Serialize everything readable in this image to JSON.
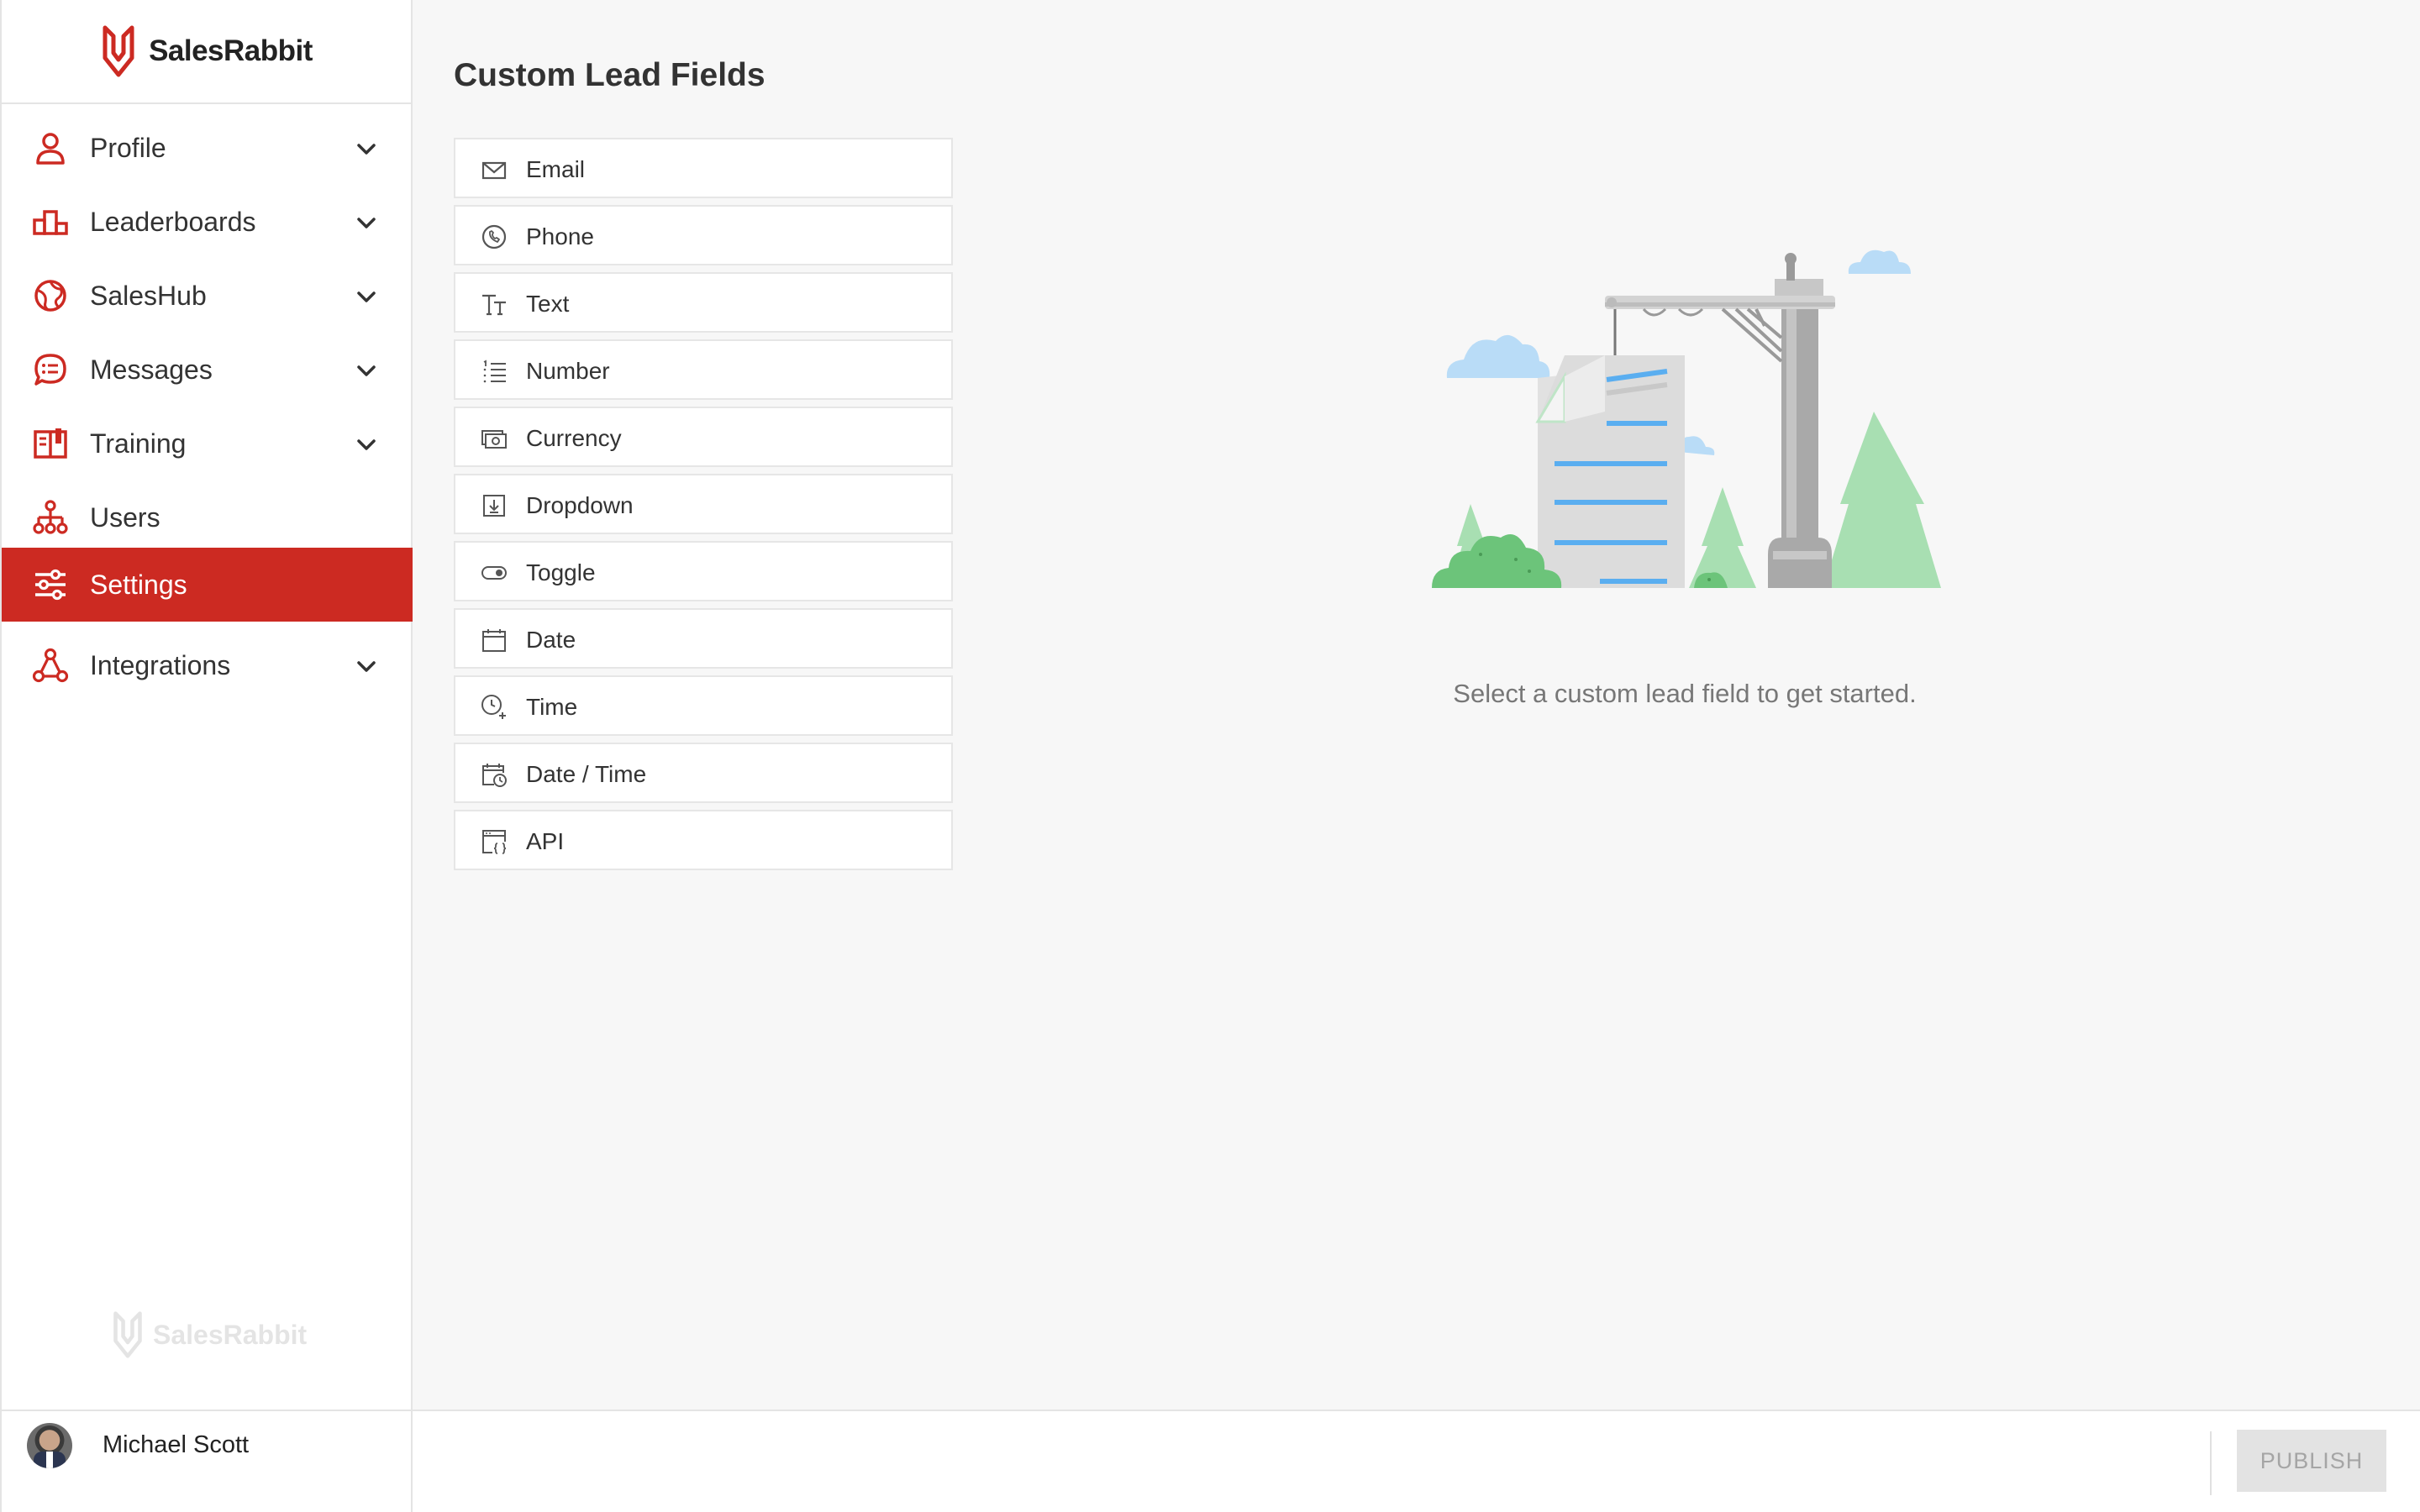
{
  "brand": {
    "name": "SalesRabbit",
    "accent": "#cc2a22"
  },
  "sidebar": {
    "items": [
      {
        "label": "Profile",
        "icon": "person-icon",
        "expandable": true
      },
      {
        "label": "Leaderboards",
        "icon": "podium-icon",
        "expandable": true
      },
      {
        "label": "SalesHub",
        "icon": "globe-icon",
        "expandable": true
      },
      {
        "label": "Messages",
        "icon": "chat-bubble-icon",
        "expandable": true
      },
      {
        "label": "Training",
        "icon": "book-icon",
        "expandable": true
      },
      {
        "label": "Users",
        "icon": "org-chart-icon",
        "expandable": false
      },
      {
        "label": "Settings",
        "icon": "sliders-icon",
        "expandable": false,
        "active": true
      },
      {
        "label": "Integrations",
        "icon": "nodes-icon",
        "expandable": true
      }
    ],
    "watermark": "SalesRabbit"
  },
  "main": {
    "title": "Custom Lead Fields",
    "fields": [
      {
        "label": "Email",
        "icon": "envelope-icon"
      },
      {
        "label": "Phone",
        "icon": "phone-icon"
      },
      {
        "label": "Text",
        "icon": "text-size-icon"
      },
      {
        "label": "Number",
        "icon": "numbered-list-icon"
      },
      {
        "label": "Currency",
        "icon": "cash-icon"
      },
      {
        "label": "Dropdown",
        "icon": "download-box-icon"
      },
      {
        "label": "Toggle",
        "icon": "toggle-icon"
      },
      {
        "label": "Date",
        "icon": "calendar-icon"
      },
      {
        "label": "Time",
        "icon": "clock-plus-icon"
      },
      {
        "label": "Date / Time",
        "icon": "calendar-clock-icon"
      },
      {
        "label": "API",
        "icon": "code-window-icon"
      }
    ],
    "empty_state": "Select a custom lead field to get started."
  },
  "footer": {
    "user_name": "Michael Scott",
    "publish_label": "PUBLISH"
  }
}
